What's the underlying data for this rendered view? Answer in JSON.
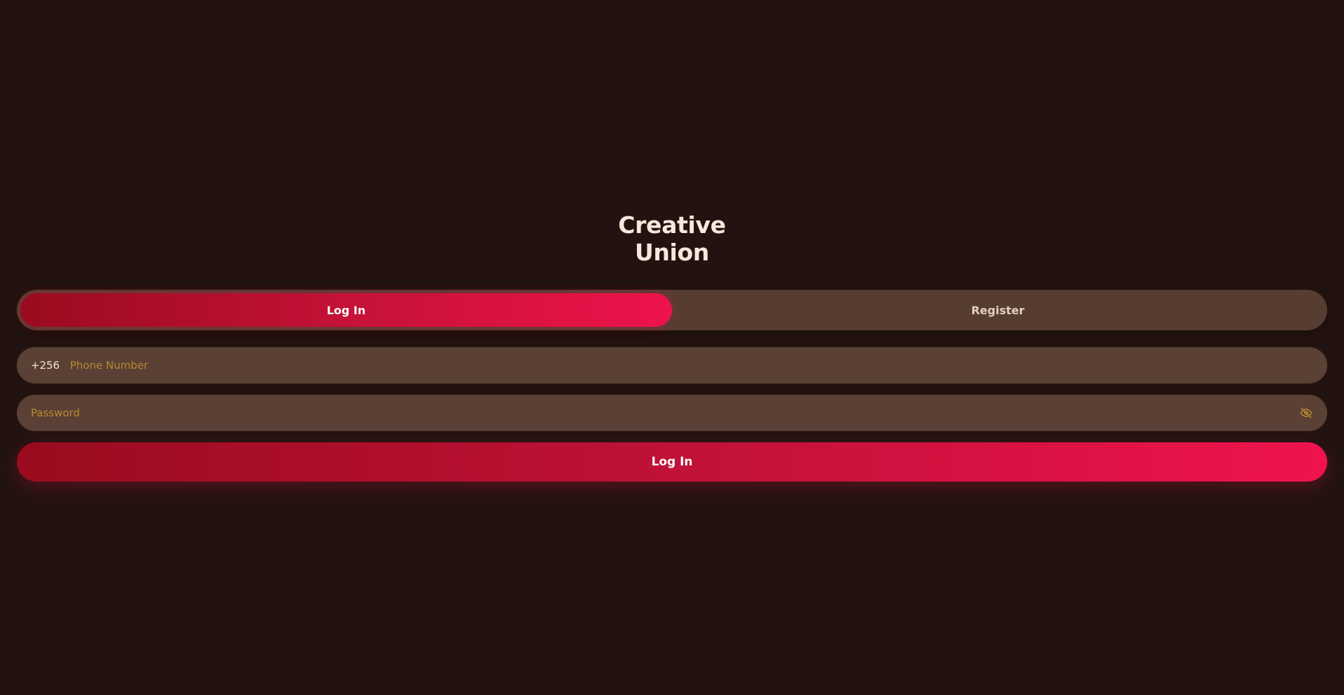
{
  "brand": {
    "line1": "Creative",
    "line2": "Union"
  },
  "tabs": [
    {
      "label": "Log In",
      "active": true
    },
    {
      "label": "Register",
      "active": false
    }
  ],
  "phone": {
    "prefix": "+256",
    "value": "",
    "placeholder": "Phone Number"
  },
  "password": {
    "value": "",
    "placeholder": "Password",
    "toggle_icon": "eye-off-icon"
  },
  "submit": {
    "label": "Log In"
  },
  "colors": {
    "background": "#231310",
    "field": "#5a4035",
    "accent_start": "#9a0b1f",
    "accent_end": "#f0134d",
    "placeholder": "#b88a2e"
  }
}
